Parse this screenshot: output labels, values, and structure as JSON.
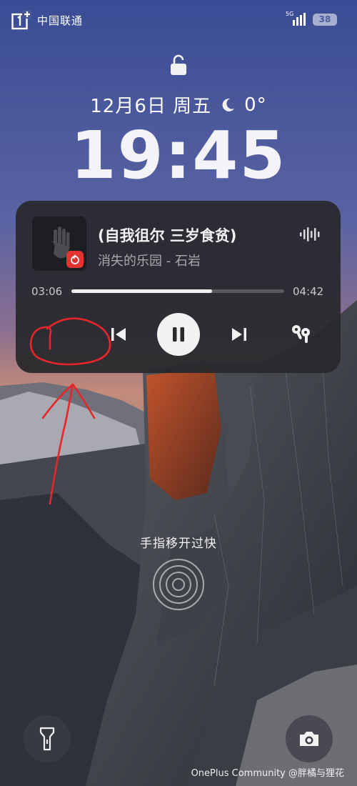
{
  "status_bar": {
    "carrier": "中国联通",
    "network_type": "5G",
    "battery_level": "38"
  },
  "lockscreen": {
    "date": "12月6日 周五",
    "temperature": "0°",
    "time": "19:45",
    "unlock_hint": "手指移开过快"
  },
  "media_player": {
    "song_title": "(自我徂尔 三岁食贫)",
    "artist_line": "消失的乐园 - 石岩",
    "time_elapsed": "03:06",
    "time_total": "04:42",
    "progress_fraction": 0.66,
    "app_badge_color": "#e3342f"
  },
  "shortcuts": {
    "left": "flashlight-icon",
    "right": "camera-icon"
  },
  "watermark": "OnePlus Community @胖橘与狸花"
}
